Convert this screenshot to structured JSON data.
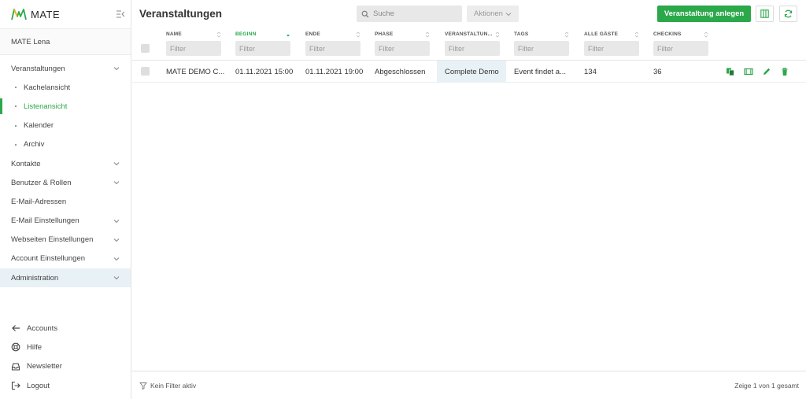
{
  "app": {
    "name": "MATE",
    "user": "MATE Lena",
    "brand_color": "#2ba84a"
  },
  "sidebar": {
    "items": [
      {
        "label": "Veranstaltungen"
      },
      {
        "label": "Kachelansicht"
      },
      {
        "label": "Listenansicht"
      },
      {
        "label": "Kalender"
      },
      {
        "label": "Archiv"
      },
      {
        "label": "Kontakte"
      },
      {
        "label": "Benutzer & Rollen"
      },
      {
        "label": "E-Mail-Adressen"
      },
      {
        "label": "E-Mail Einstellungen"
      },
      {
        "label": "Webseiten Einstellungen"
      },
      {
        "label": "Account Einstellungen"
      },
      {
        "label": "Administration"
      }
    ],
    "bottom": [
      {
        "label": "Accounts",
        "icon": "arrow-left-icon"
      },
      {
        "label": "Hilfe",
        "icon": "lifebuoy-icon"
      },
      {
        "label": "Newsletter",
        "icon": "inbox-icon"
      },
      {
        "label": "Logout",
        "icon": "logout-icon"
      }
    ]
  },
  "header": {
    "title": "Veranstaltungen",
    "search_placeholder": "Suche",
    "actions_label": "Aktionen",
    "create_label": "Veranstaltung anlegen"
  },
  "table": {
    "filter_placeholder": "Filter",
    "columns": [
      "NAME",
      "BEGINN",
      "ENDE",
      "PHASE",
      "VERANSTALTUN...",
      "TAGS",
      "ALLE GÄSTE",
      "CHECKINS"
    ],
    "sorted_column": "BEGINN",
    "rows": [
      {
        "name": "MATE DEMO C...",
        "begin": "01.11.2021 15:00",
        "end": "01.11.2021 19:00",
        "phase": "Abgeschlossen",
        "type": "Complete Demo",
        "tags": "Event findet a...",
        "guests": "134",
        "checkins": "36"
      }
    ]
  },
  "footer": {
    "filter_status": "Kein Filter aktiv",
    "pagination": "Zeige 1 von 1 gesamt"
  }
}
